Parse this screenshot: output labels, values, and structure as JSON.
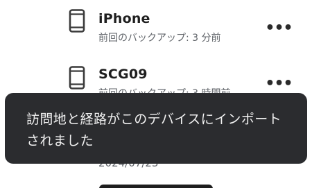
{
  "devices": [
    {
      "icon": "smartphone-icon",
      "name": "iPhone",
      "last_backup": "前回のバックアップ: 3 分前",
      "more": "•••"
    },
    {
      "icon": "smartphone-icon",
      "name": "SCG09",
      "last_backup": "前回のバックアップ: 3 時間前",
      "more": "•••"
    }
  ],
  "partial_date": "2024/07/23",
  "snackbar": {
    "message": "訪問地と経路がこのデバイスにインポートされました"
  },
  "colors": {
    "snackbar_background": "#2b2c2f",
    "snackbar_text": "#f1f1f1",
    "primary_text": "#1f1f1f",
    "secondary_text": "#5f6368"
  }
}
